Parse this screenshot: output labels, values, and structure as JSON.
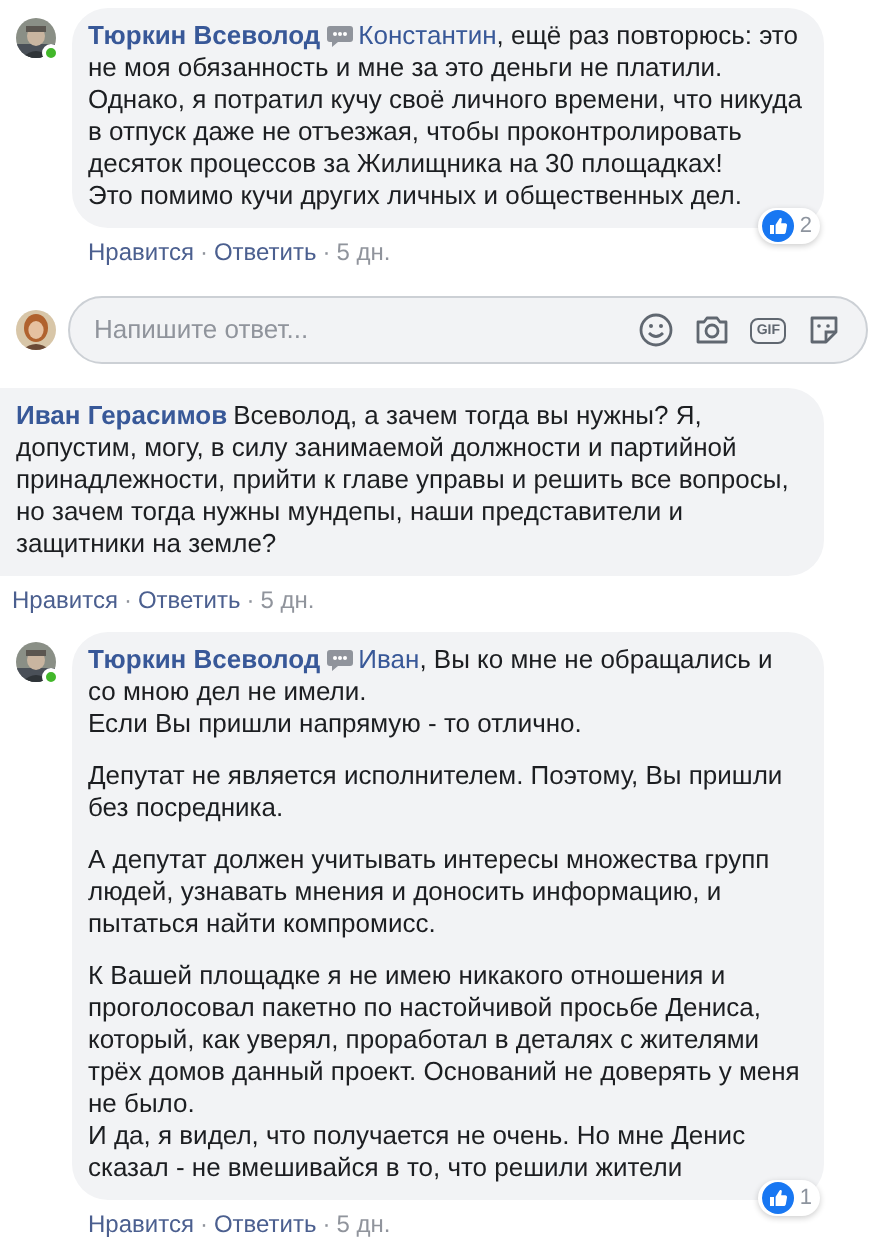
{
  "thread": [
    {
      "kind": "comment",
      "author": "Тюркин Всеволод",
      "avatar": true,
      "online": true,
      "messenger_icon": true,
      "mention": "Константин",
      "paragraphs": [
        ", ещё раз повторюсь: это не моя обязанность и мне за это деньги не платили. Однако, я потратил кучу своё личного времени, что никуда в отпуск даже не отъезжая, чтобы проконтролировать десяток процессов за Жилищника на 30 площадках!\nЭто помимо кучи других личных и общественных дел."
      ],
      "reaction": {
        "kind": "like",
        "count": "2"
      },
      "actions": [
        {
          "kind": "link",
          "label": "Нравится"
        },
        {
          "kind": "link",
          "label": "Ответить"
        },
        {
          "kind": "time",
          "label": "5 дн."
        }
      ],
      "separator": "·"
    },
    {
      "kind": "reply_box",
      "placeholder": "Напишите ответ...",
      "gif_label": "GIF"
    },
    {
      "kind": "comment",
      "author": "Иван Герасимов",
      "avatar": false,
      "messenger_icon": false,
      "paragraphs": [
        "Всеволод, а зачем тогда вы нужны? Я, допустим, могу, в силу занимаемой должности и партийной принадлежности, прийти к главе управы и решить все вопросы, но зачем тогда нужны мундепы, наши представители и защитники на земле?"
      ],
      "actions": [
        {
          "kind": "link",
          "label": "Нравится"
        },
        {
          "kind": "link",
          "label": "Ответить"
        },
        {
          "kind": "time",
          "label": "5 дн."
        }
      ],
      "separator": "·"
    },
    {
      "kind": "comment",
      "author": "Тюркин Всеволод",
      "avatar": true,
      "online": true,
      "messenger_icon": true,
      "mention": "Иван",
      "paragraphs": [
        ", Вы ко мне не обращались и со мною дел не имели.\nЕсли Вы пришли напрямую - то отлично.",
        "Депутат не является исполнителем. Поэтому, Вы пришли без посредника.",
        "А депутат должен учитывать интересы множества групп людей, узнавать мнения и доносить информацию, и пытаться найти компромисс.",
        "К Вашей площадке я не имею никакого отношения и проголосовал пакетно по настойчивой просьбе Дениса, который, как уверял, проработал в деталях с жителями трёх домов данный проект. Оснований не доверять у меня не было.\nИ да, я видел, что получается не очень. Но мне Денис сказал - не вмешивайся в то, что решили жители"
      ],
      "reaction": {
        "kind": "like",
        "count": "1"
      },
      "actions": [
        {
          "kind": "link",
          "label": "Нравится"
        },
        {
          "kind": "link",
          "label": "Ответить"
        },
        {
          "kind": "time",
          "label": "5 дн."
        }
      ],
      "separator": "·"
    }
  ]
}
